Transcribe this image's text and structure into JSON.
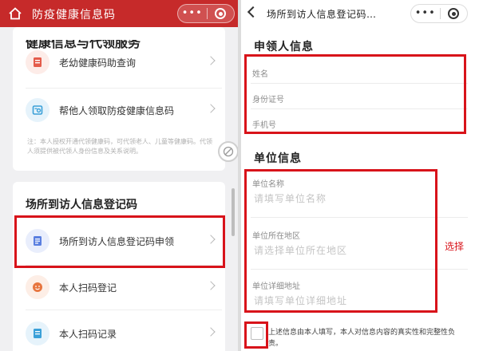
{
  "left": {
    "app_title": "防疫健康信息码",
    "capsule_dots": "•••",
    "card1": {
      "heading_partial": "健康信息与代领服务",
      "items": [
        {
          "label": "老幼健康码助查询",
          "icon": "document-icon",
          "icon_color": "#e45b4a"
        },
        {
          "label": "帮他人领取防疫健康信息码",
          "icon": "scan-card-icon",
          "icon_color": "#3aa0d8"
        }
      ],
      "note": "注：本人授权开通代领健康码，可代领老人、儿童等健康码。代领人须提供被代领人身份信息及关系说明。"
    },
    "card2": {
      "title": "场所到访人信息登记码",
      "items": [
        {
          "label": "场所到访人信息登记码申领",
          "icon": "list-doc-icon",
          "icon_color": "#5a7fe0"
        },
        {
          "label": "本人扫码登记",
          "icon": "face-icon",
          "icon_color": "#e7753f"
        },
        {
          "label": "本人扫码记录",
          "icon": "record-icon",
          "icon_color": "#3aa0d8"
        }
      ]
    }
  },
  "right": {
    "page_title": "场所到访人信息登记码…",
    "capsule_dots": "•••",
    "applicant": {
      "title": "申领人信息",
      "fields": [
        {
          "label": "姓名"
        },
        {
          "label": "身份证号"
        },
        {
          "label": "手机号"
        }
      ]
    },
    "unit": {
      "title": "单位信息",
      "fields": [
        {
          "label": "单位名称",
          "placeholder": "请填写单位名称"
        },
        {
          "label": "单位所在地区",
          "placeholder": "请选择单位所在地区"
        },
        {
          "label": "单位详细地址",
          "placeholder": "请填写单位详细地址"
        }
      ]
    },
    "side_note": "选择",
    "agreement": "上述信息由本人填写，本人对信息内容的真实性和完整性负责。"
  },
  "colors": {
    "brand_red": "#c62a2a",
    "highlight_red": "#d8131a"
  }
}
